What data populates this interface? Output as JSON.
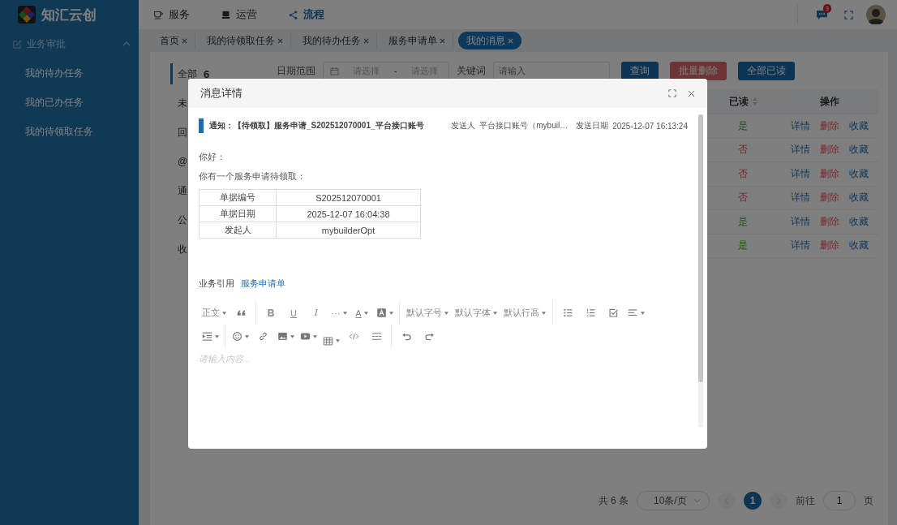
{
  "sidebar": {
    "logo_text": "知汇云创",
    "groups": [
      {
        "label": "业务审批",
        "expanded": true,
        "children": [
          {
            "label": "我的待办任务"
          },
          {
            "label": "我的已办任务"
          },
          {
            "label": "我的待领取任务"
          }
        ]
      }
    ]
  },
  "header": {
    "nav": [
      {
        "label": "服务",
        "kind": "cup",
        "selected": false
      },
      {
        "label": "运营",
        "kind": "card",
        "selected": false
      },
      {
        "label": "流程",
        "kind": "share",
        "selected": true
      }
    ],
    "message_badge": "3"
  },
  "tabs": [
    {
      "label": "首页",
      "selected": false
    },
    {
      "label": "我的待领取任务",
      "selected": false
    },
    {
      "label": "我的待办任务",
      "selected": false
    },
    {
      "label": "服务申请单",
      "selected": false
    },
    {
      "label": "我的消息",
      "selected": true
    }
  ],
  "categories": [
    {
      "label": "全部",
      "count": "6",
      "selected": true
    },
    {
      "label": "未",
      "selected": false
    },
    {
      "label": "回",
      "selected": false
    },
    {
      "label": "@",
      "selected": false
    },
    {
      "label": "通",
      "selected": false
    },
    {
      "label": "公",
      "selected": false
    },
    {
      "label": "收",
      "selected": false
    }
  ],
  "filters": {
    "date_label": "日期范围",
    "date_start_placeholder": "请选择",
    "date_separator": "-",
    "date_end_placeholder": "请选择",
    "keyword_label": "关键词",
    "keyword_placeholder": "请输入",
    "buttons": [
      {
        "label": "查询",
        "kind": "primary",
        "disabled": false
      },
      {
        "label": "批量删除",
        "kind": "danger",
        "disabled": true
      },
      {
        "label": "全部已读",
        "kind": "primary",
        "disabled": false
      }
    ]
  },
  "table": {
    "columns": [
      "已读",
      "操作"
    ],
    "rows": [
      {
        "read": "是",
        "is_read": true,
        "actions": [
          {
            "label": "详情",
            "kind": "link"
          },
          {
            "label": "删除",
            "kind": "danger"
          },
          {
            "label": "收藏",
            "kind": "link"
          }
        ]
      },
      {
        "read": "否",
        "is_read": false,
        "actions": [
          {
            "label": "详情",
            "kind": "link"
          },
          {
            "label": "删除",
            "kind": "danger"
          },
          {
            "label": "收藏",
            "kind": "link"
          }
        ]
      },
      {
        "read": "否",
        "is_read": false,
        "actions": [
          {
            "label": "详情",
            "kind": "link"
          },
          {
            "label": "删除",
            "kind": "danger"
          },
          {
            "label": "收藏",
            "kind": "link"
          }
        ]
      },
      {
        "read": "否",
        "is_read": false,
        "actions": [
          {
            "label": "详情",
            "kind": "link"
          },
          {
            "label": "删除",
            "kind": "danger"
          },
          {
            "label": "收藏",
            "kind": "link"
          }
        ]
      },
      {
        "read": "是",
        "is_read": true,
        "actions": [
          {
            "label": "详情",
            "kind": "link"
          },
          {
            "label": "删除",
            "kind": "danger"
          },
          {
            "label": "收藏",
            "kind": "link"
          }
        ]
      },
      {
        "read": "是",
        "is_read": true,
        "actions": [
          {
            "label": "详情",
            "kind": "link"
          },
          {
            "label": "删除",
            "kind": "danger"
          },
          {
            "label": "收藏",
            "kind": "link"
          }
        ]
      }
    ]
  },
  "pagination": {
    "total": "共 6 条",
    "page_size": "10条/页",
    "pages": [
      {
        "label": "1",
        "selected": true
      }
    ],
    "goto_label": "前往",
    "goto_value": "1",
    "page_suffix": "页"
  },
  "dialog": {
    "title": "消息详情",
    "notice_title": "通知：【待领取】服务申请_S202512070001_平台接口账号",
    "sender_label": "发送人",
    "sender": "平台接口账号（mybuil…",
    "date_label": "发送日期",
    "date": "2025-12-07 16:13:24",
    "greeting": "你好：",
    "intro": "你有一个服务申请待领取：",
    "details": [
      {
        "key": "单据编号",
        "value": "S202512070001"
      },
      {
        "key": "单据日期",
        "value": "2025-12-07 16:04:38"
      },
      {
        "key": "发起人",
        "value": "mybuilderOpt"
      }
    ],
    "reference_label": "业务引用",
    "reference_link": "服务申请单",
    "toolbar": [
      [
        [
          {
            "kind": "select",
            "label": "正文",
            "caret": true
          },
          {
            "kind": "quote",
            "caret": false
          }
        ],
        [
          {
            "kind": "bold",
            "label": "B",
            "caret": false
          },
          {
            "kind": "underline",
            "label": "U",
            "caret": false
          },
          {
            "kind": "italic",
            "label": "I",
            "caret": false
          },
          {
            "kind": "more",
            "label": "···",
            "caret": true
          },
          {
            "kind": "fontcolor",
            "label": "A",
            "caret": true
          },
          {
            "kind": "bgcolor",
            "caret": true
          }
        ],
        [
          {
            "kind": "select",
            "label": "默认字号",
            "caret": true
          },
          {
            "kind": "select",
            "label": "默认字体",
            "caret": true
          },
          {
            "kind": "select",
            "label": "默认行高",
            "caret": true
          }
        ],
        [
          {
            "kind": "bullets",
            "caret": false
          },
          {
            "kind": "numbers",
            "caret": false
          },
          {
            "kind": "todo",
            "caret": false
          },
          {
            "kind": "align",
            "caret": true
          }
        ]
      ],
      [
        [
          {
            "kind": "indent",
            "caret": true
          }
        ],
        [
          {
            "kind": "emoji",
            "caret": true
          },
          {
            "kind": "link",
            "caret": false
          },
          {
            "kind": "image",
            "caret": true
          },
          {
            "kind": "video",
            "caret": true
          },
          {
            "kind": "table",
            "caret": true
          },
          {
            "kind": "code",
            "caret": false
          },
          {
            "kind": "divider",
            "caret": false
          }
        ],
        [
          {
            "kind": "undo",
            "caret": false
          },
          {
            "kind": "redo",
            "caret": false
          }
        ]
      ]
    ],
    "editor_placeholder": "请输入内容..."
  }
}
